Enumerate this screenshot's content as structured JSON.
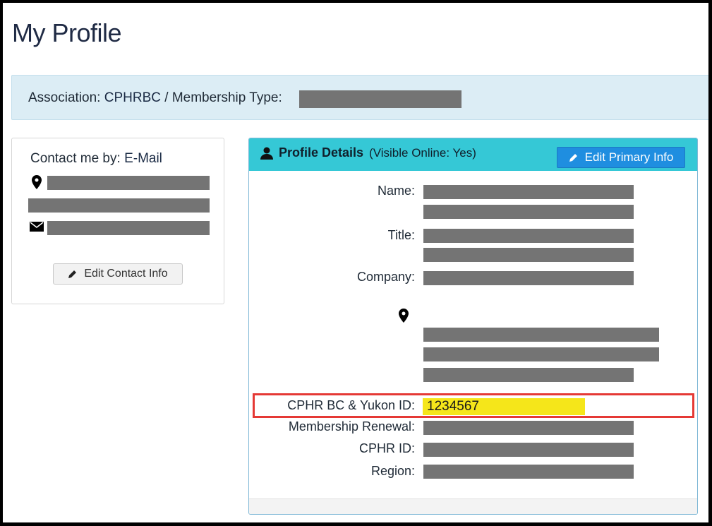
{
  "page": {
    "title": "My Profile"
  },
  "association_bar": {
    "association_label": "Association:",
    "association_value": "CPHRBC",
    "separator": "/",
    "membership_type_label": "Membership Type:",
    "membership_type_value": ""
  },
  "contact_panel": {
    "contact_by_label": "Contact me by:",
    "contact_by_value": "E-Mail",
    "edit_button_label": "Edit Contact Info"
  },
  "profile_panel": {
    "title": "Profile Details",
    "visibility": "(Visible Online: Yes)",
    "edit_button_label": "Edit Primary Info",
    "labels": {
      "name": "Name:",
      "title": "Title:",
      "company": "Company:",
      "cphr_bc_yukon_id": "CPHR BC & Yukon ID:",
      "membership_renewal": "Membership Renewal:",
      "cphr_id": "CPHR ID:",
      "region": "Region:"
    },
    "values": {
      "cphr_bc_yukon_id": "1234567"
    }
  },
  "colors": {
    "header_accent": "#35c8d6",
    "button_primary": "#1f8ee0",
    "highlight_yellow": "#f5e61a",
    "highlight_border": "#e53935",
    "redaction": "#747474"
  },
  "icons": [
    "map-marker-icon",
    "envelope-icon",
    "pencil-icon",
    "user-icon"
  ]
}
